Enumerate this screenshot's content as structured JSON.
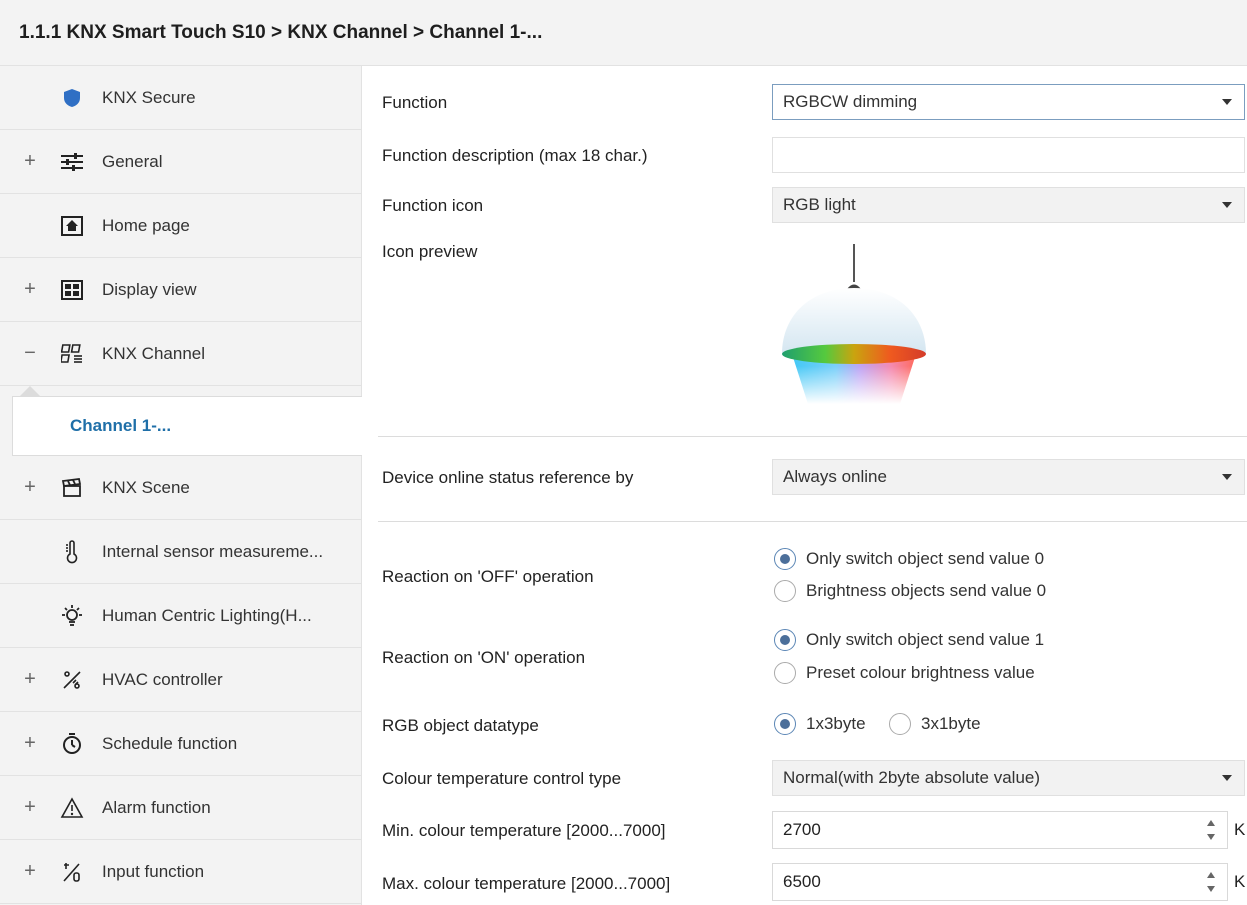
{
  "header": {
    "breadcrumb": "1.1.1 KNX Smart Touch S10 > KNX Channel  > Channel 1-..."
  },
  "sidebar": {
    "items": [
      {
        "label": "KNX Secure",
        "expander": "",
        "icon": "shield-icon"
      },
      {
        "label": "General",
        "expander": "+",
        "icon": "sliders-icon"
      },
      {
        "label": "Home page",
        "expander": "",
        "icon": "home-icon"
      },
      {
        "label": "Display view",
        "expander": "+",
        "icon": "grid-view-icon"
      },
      {
        "label": "KNX Channel",
        "expander": "−",
        "icon": "channel-icon"
      },
      {
        "label": "Channel 1-...",
        "expander": "",
        "icon": ""
      },
      {
        "label": "KNX Scene",
        "expander": "+",
        "icon": "clapperboard-icon"
      },
      {
        "label": "Internal sensor measureme...",
        "expander": "",
        "icon": "thermometer-icon"
      },
      {
        "label": "Human Centric Lighting(H...",
        "expander": "",
        "icon": "bulb-icon"
      },
      {
        "label": "HVAC controller",
        "expander": "+",
        "icon": "hvac-icon"
      },
      {
        "label": "Schedule function",
        "expander": "+",
        "icon": "timer-icon"
      },
      {
        "label": "Alarm function",
        "expander": "+",
        "icon": "warning-icon"
      },
      {
        "label": "Input function",
        "expander": "+",
        "icon": "input-icon"
      }
    ]
  },
  "form": {
    "function_label": "Function",
    "function_value": "RGBCW dimming",
    "desc_label": "Function description (max 18 char.)",
    "desc_value": "",
    "icon_label": "Function icon",
    "icon_value": "RGB light",
    "preview_label": "Icon preview",
    "online_label": "Device online status reference by",
    "online_value": "Always online",
    "off_label": "Reaction on 'OFF' operation",
    "off_opt1": "Only switch object send value 0",
    "off_opt2": "Brightness objects send value 0",
    "off_selected": 1,
    "on_label": "Reaction on 'ON' operation",
    "on_opt1": "Only switch object send value 1",
    "on_opt2": "Preset colour brightness value",
    "on_selected": 1,
    "rgb_label": "RGB object datatype",
    "rgb_opt1": "1x3byte",
    "rgb_opt2": "3x1byte",
    "rgb_selected": 1,
    "ct_type_label": "Colour temperature control type",
    "ct_type_value": "Normal(with 2byte absolute value)",
    "min_ct_label": "Min. colour temperature [2000...7000]",
    "min_ct_value": "2700",
    "max_ct_label": "Max. colour temperature [2000...7000]",
    "max_ct_value": "6500",
    "unit": "K"
  }
}
